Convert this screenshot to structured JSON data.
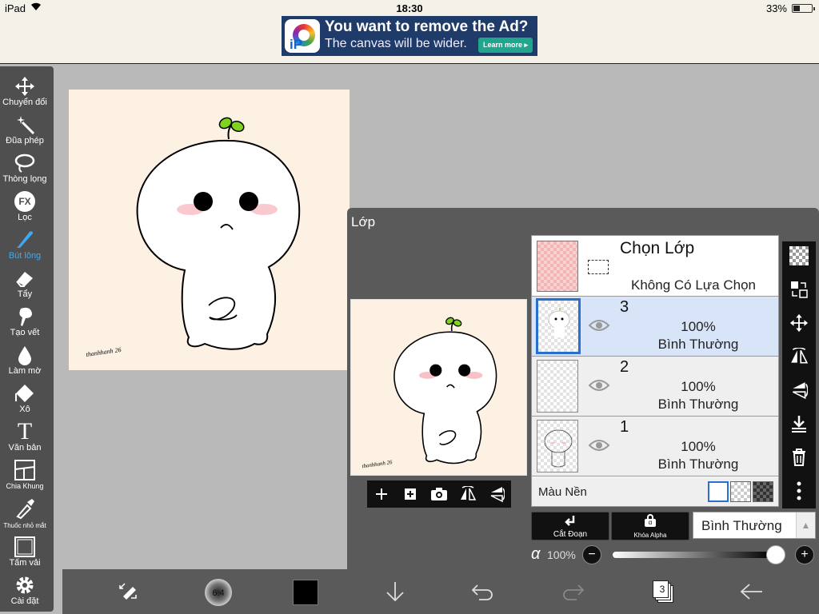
{
  "status_bar": {
    "device": "iPad",
    "time": "18:30",
    "battery": "33%"
  },
  "ad": {
    "line1": "You want to remove the Ad?",
    "line2": "The canvas will be wider.",
    "button": "Learn more ▸",
    "logo_text": "iP"
  },
  "toolbar": {
    "items": [
      {
        "label": "Chuyển đổi",
        "icon": "move-icon"
      },
      {
        "label": "Đũa phép",
        "icon": "magic-wand-icon"
      },
      {
        "label": "Thòng lọng",
        "icon": "lasso-icon"
      },
      {
        "label": "Lọc",
        "icon": "fx-filter-icon",
        "icon_text": "FX"
      },
      {
        "label": "Bút lông",
        "icon": "brush-icon",
        "active": true
      },
      {
        "label": "Tẩy",
        "icon": "eraser-icon"
      },
      {
        "label": "Tạo vết",
        "icon": "smudge-icon"
      },
      {
        "label": "Làm mờ",
        "icon": "blur-icon"
      },
      {
        "label": "Xô",
        "icon": "bucket-icon"
      },
      {
        "label": "Văn bản",
        "icon": "text-icon",
        "icon_text": "T"
      },
      {
        "label": "Chia Khung",
        "icon": "frame-divider-icon"
      },
      {
        "label": "Thuốc nhỏ mắt",
        "icon": "eyedropper-icon"
      },
      {
        "label": "Tấm vải",
        "icon": "canvas-icon"
      },
      {
        "label": "Cài đặt",
        "icon": "settings-gear-icon"
      }
    ]
  },
  "artwork": {
    "signature": "thanhhanh 26"
  },
  "layer_panel": {
    "title": "Lớp",
    "selection_layer": {
      "title": "Chọn Lớp",
      "subtitle": "Không Có Lựa Chọn"
    },
    "layers": [
      {
        "number": "3",
        "opacity": "100%",
        "blend": "Bình Thường",
        "selected": true
      },
      {
        "number": "2",
        "opacity": "100%",
        "blend": "Bình Thường",
        "selected": false
      },
      {
        "number": "1",
        "opacity": "100%",
        "blend": "Bình Thường",
        "selected": false
      }
    ],
    "background": {
      "label": "Màu Nền"
    },
    "buttons": {
      "clip": "Cắt Đoạn",
      "alpha_lock": "Khóa Alpha",
      "alpha_lock_icon_text": "α"
    },
    "blend_mode": "Bình Thường",
    "alpha": {
      "symbol": "α",
      "value": "100%",
      "level": 1.0
    }
  },
  "bottom_bar": {
    "brush_size": "6.4",
    "color": "#000000",
    "layer_count": "3"
  },
  "colors": {
    "accent": "#3fa9f5",
    "selected_layer": "#d8e4f8",
    "panel": "#5a5a5a",
    "toolbar": "#4f4f4f",
    "canvas_bg": "#fdf1e3"
  }
}
